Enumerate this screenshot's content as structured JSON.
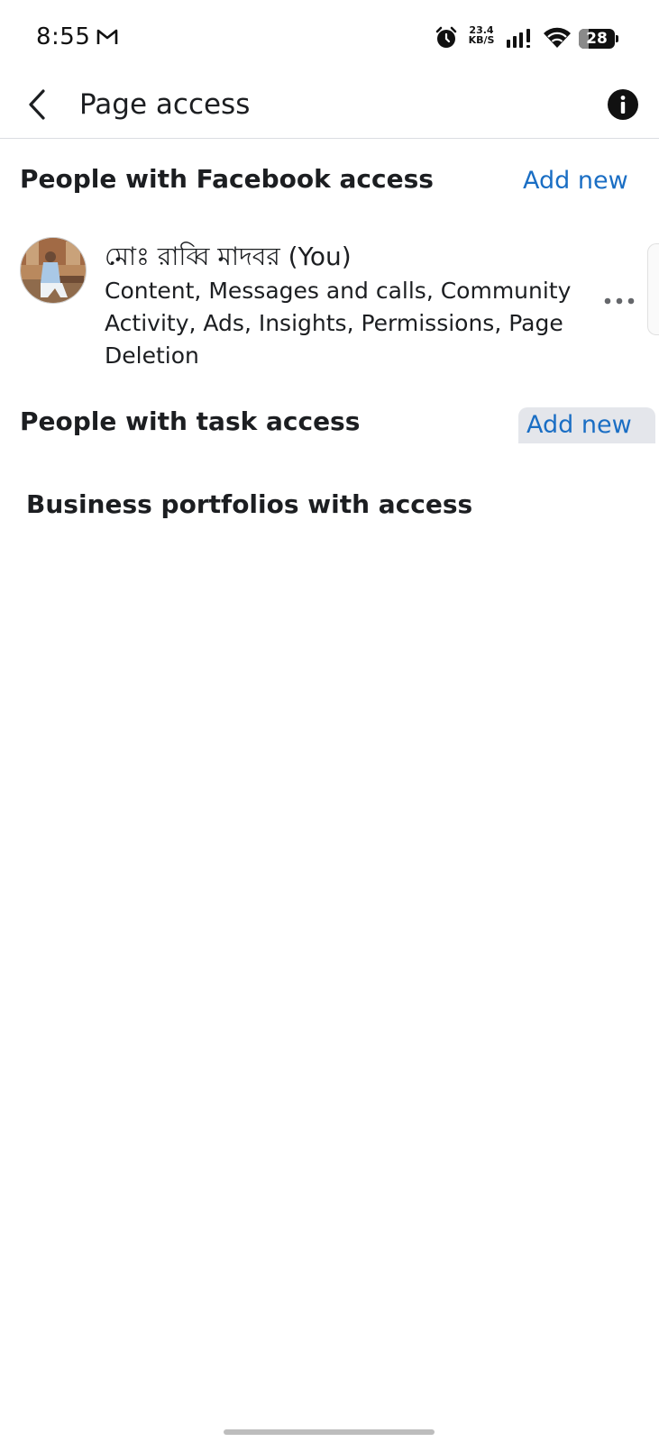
{
  "status_bar": {
    "time": "8:55",
    "net_speed_value": "23.4",
    "net_speed_unit": "KB/S",
    "battery_level": "28",
    "battery_fraction": 0.28,
    "icons": [
      "gmail-icon",
      "alarm-icon",
      "signal-icon",
      "wifi-icon",
      "battery-icon"
    ]
  },
  "app_bar": {
    "title": "Page access",
    "back_icon": "chevron-left-icon",
    "info_icon": "info-icon"
  },
  "facebook_access": {
    "title": "People with Facebook access",
    "add_label": "Add new",
    "people": [
      {
        "name": "মোঃ রাব্বি মাদবর (You)",
        "permissions": "Content, Messages and calls, Community Activity, Ads, Insights, Permissions, Page Deletion"
      }
    ]
  },
  "task_access": {
    "title": "People with task access",
    "add_label": "Add new"
  },
  "business_portfolios": {
    "title": "Business portfolios with access"
  },
  "colors": {
    "link_blue": "#1a6ec4",
    "text": "#1c1e21",
    "divider": "#dadde1",
    "pressed_bg": "#e4e6eb"
  }
}
